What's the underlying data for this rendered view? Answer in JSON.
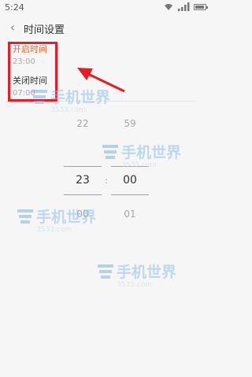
{
  "status_bar": {
    "time": "5:24"
  },
  "header": {
    "title": "时间设置"
  },
  "settings": [
    {
      "label": "开启时间",
      "value": "23:00"
    },
    {
      "label": "关闭时间",
      "value": "07:00"
    }
  ],
  "time_picker": {
    "hour": {
      "prev": "22",
      "current": "23",
      "next": "00"
    },
    "separator": ":",
    "minute": {
      "prev": "59",
      "current": "00",
      "next": "01"
    }
  },
  "watermark": {
    "text": "手机世界",
    "subtext": "3533.com"
  },
  "colors": {
    "accent": "#e8682f",
    "highlight": "#e01f26",
    "picker_line": "#5fb2e6"
  },
  "icons": [
    "back-arrow-icon",
    "wifi-icon",
    "signal-icon",
    "battery-icon"
  ]
}
